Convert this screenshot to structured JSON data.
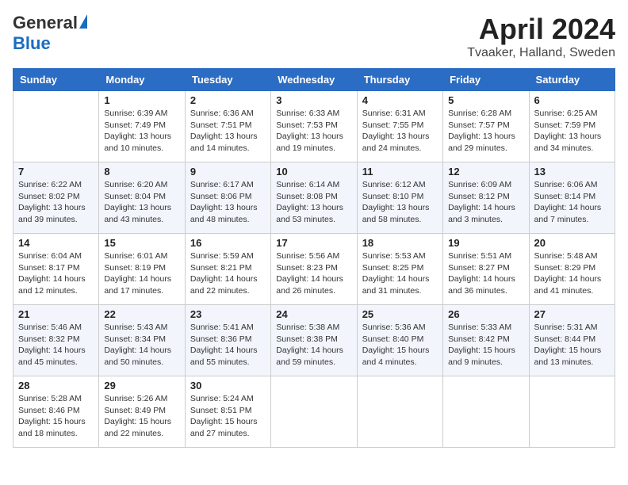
{
  "header": {
    "logo_general": "General",
    "logo_blue": "Blue",
    "month_title": "April 2024",
    "location": "Tvaaker, Halland, Sweden"
  },
  "days_of_week": [
    "Sunday",
    "Monday",
    "Tuesday",
    "Wednesday",
    "Thursday",
    "Friday",
    "Saturday"
  ],
  "weeks": [
    [
      {
        "num": "",
        "sunrise": "",
        "sunset": "",
        "daylight": ""
      },
      {
        "num": "1",
        "sunrise": "Sunrise: 6:39 AM",
        "sunset": "Sunset: 7:49 PM",
        "daylight": "Daylight: 13 hours and 10 minutes."
      },
      {
        "num": "2",
        "sunrise": "Sunrise: 6:36 AM",
        "sunset": "Sunset: 7:51 PM",
        "daylight": "Daylight: 13 hours and 14 minutes."
      },
      {
        "num": "3",
        "sunrise": "Sunrise: 6:33 AM",
        "sunset": "Sunset: 7:53 PM",
        "daylight": "Daylight: 13 hours and 19 minutes."
      },
      {
        "num": "4",
        "sunrise": "Sunrise: 6:31 AM",
        "sunset": "Sunset: 7:55 PM",
        "daylight": "Daylight: 13 hours and 24 minutes."
      },
      {
        "num": "5",
        "sunrise": "Sunrise: 6:28 AM",
        "sunset": "Sunset: 7:57 PM",
        "daylight": "Daylight: 13 hours and 29 minutes."
      },
      {
        "num": "6",
        "sunrise": "Sunrise: 6:25 AM",
        "sunset": "Sunset: 7:59 PM",
        "daylight": "Daylight: 13 hours and 34 minutes."
      }
    ],
    [
      {
        "num": "7",
        "sunrise": "Sunrise: 6:22 AM",
        "sunset": "Sunset: 8:02 PM",
        "daylight": "Daylight: 13 hours and 39 minutes."
      },
      {
        "num": "8",
        "sunrise": "Sunrise: 6:20 AM",
        "sunset": "Sunset: 8:04 PM",
        "daylight": "Daylight: 13 hours and 43 minutes."
      },
      {
        "num": "9",
        "sunrise": "Sunrise: 6:17 AM",
        "sunset": "Sunset: 8:06 PM",
        "daylight": "Daylight: 13 hours and 48 minutes."
      },
      {
        "num": "10",
        "sunrise": "Sunrise: 6:14 AM",
        "sunset": "Sunset: 8:08 PM",
        "daylight": "Daylight: 13 hours and 53 minutes."
      },
      {
        "num": "11",
        "sunrise": "Sunrise: 6:12 AM",
        "sunset": "Sunset: 8:10 PM",
        "daylight": "Daylight: 13 hours and 58 minutes."
      },
      {
        "num": "12",
        "sunrise": "Sunrise: 6:09 AM",
        "sunset": "Sunset: 8:12 PM",
        "daylight": "Daylight: 14 hours and 3 minutes."
      },
      {
        "num": "13",
        "sunrise": "Sunrise: 6:06 AM",
        "sunset": "Sunset: 8:14 PM",
        "daylight": "Daylight: 14 hours and 7 minutes."
      }
    ],
    [
      {
        "num": "14",
        "sunrise": "Sunrise: 6:04 AM",
        "sunset": "Sunset: 8:17 PM",
        "daylight": "Daylight: 14 hours and 12 minutes."
      },
      {
        "num": "15",
        "sunrise": "Sunrise: 6:01 AM",
        "sunset": "Sunset: 8:19 PM",
        "daylight": "Daylight: 14 hours and 17 minutes."
      },
      {
        "num": "16",
        "sunrise": "Sunrise: 5:59 AM",
        "sunset": "Sunset: 8:21 PM",
        "daylight": "Daylight: 14 hours and 22 minutes."
      },
      {
        "num": "17",
        "sunrise": "Sunrise: 5:56 AM",
        "sunset": "Sunset: 8:23 PM",
        "daylight": "Daylight: 14 hours and 26 minutes."
      },
      {
        "num": "18",
        "sunrise": "Sunrise: 5:53 AM",
        "sunset": "Sunset: 8:25 PM",
        "daylight": "Daylight: 14 hours and 31 minutes."
      },
      {
        "num": "19",
        "sunrise": "Sunrise: 5:51 AM",
        "sunset": "Sunset: 8:27 PM",
        "daylight": "Daylight: 14 hours and 36 minutes."
      },
      {
        "num": "20",
        "sunrise": "Sunrise: 5:48 AM",
        "sunset": "Sunset: 8:29 PM",
        "daylight": "Daylight: 14 hours and 41 minutes."
      }
    ],
    [
      {
        "num": "21",
        "sunrise": "Sunrise: 5:46 AM",
        "sunset": "Sunset: 8:32 PM",
        "daylight": "Daylight: 14 hours and 45 minutes."
      },
      {
        "num": "22",
        "sunrise": "Sunrise: 5:43 AM",
        "sunset": "Sunset: 8:34 PM",
        "daylight": "Daylight: 14 hours and 50 minutes."
      },
      {
        "num": "23",
        "sunrise": "Sunrise: 5:41 AM",
        "sunset": "Sunset: 8:36 PM",
        "daylight": "Daylight: 14 hours and 55 minutes."
      },
      {
        "num": "24",
        "sunrise": "Sunrise: 5:38 AM",
        "sunset": "Sunset: 8:38 PM",
        "daylight": "Daylight: 14 hours and 59 minutes."
      },
      {
        "num": "25",
        "sunrise": "Sunrise: 5:36 AM",
        "sunset": "Sunset: 8:40 PM",
        "daylight": "Daylight: 15 hours and 4 minutes."
      },
      {
        "num": "26",
        "sunrise": "Sunrise: 5:33 AM",
        "sunset": "Sunset: 8:42 PM",
        "daylight": "Daylight: 15 hours and 9 minutes."
      },
      {
        "num": "27",
        "sunrise": "Sunrise: 5:31 AM",
        "sunset": "Sunset: 8:44 PM",
        "daylight": "Daylight: 15 hours and 13 minutes."
      }
    ],
    [
      {
        "num": "28",
        "sunrise": "Sunrise: 5:28 AM",
        "sunset": "Sunset: 8:46 PM",
        "daylight": "Daylight: 15 hours and 18 minutes."
      },
      {
        "num": "29",
        "sunrise": "Sunrise: 5:26 AM",
        "sunset": "Sunset: 8:49 PM",
        "daylight": "Daylight: 15 hours and 22 minutes."
      },
      {
        "num": "30",
        "sunrise": "Sunrise: 5:24 AM",
        "sunset": "Sunset: 8:51 PM",
        "daylight": "Daylight: 15 hours and 27 minutes."
      },
      {
        "num": "",
        "sunrise": "",
        "sunset": "",
        "daylight": ""
      },
      {
        "num": "",
        "sunrise": "",
        "sunset": "",
        "daylight": ""
      },
      {
        "num": "",
        "sunrise": "",
        "sunset": "",
        "daylight": ""
      },
      {
        "num": "",
        "sunrise": "",
        "sunset": "",
        "daylight": ""
      }
    ]
  ]
}
